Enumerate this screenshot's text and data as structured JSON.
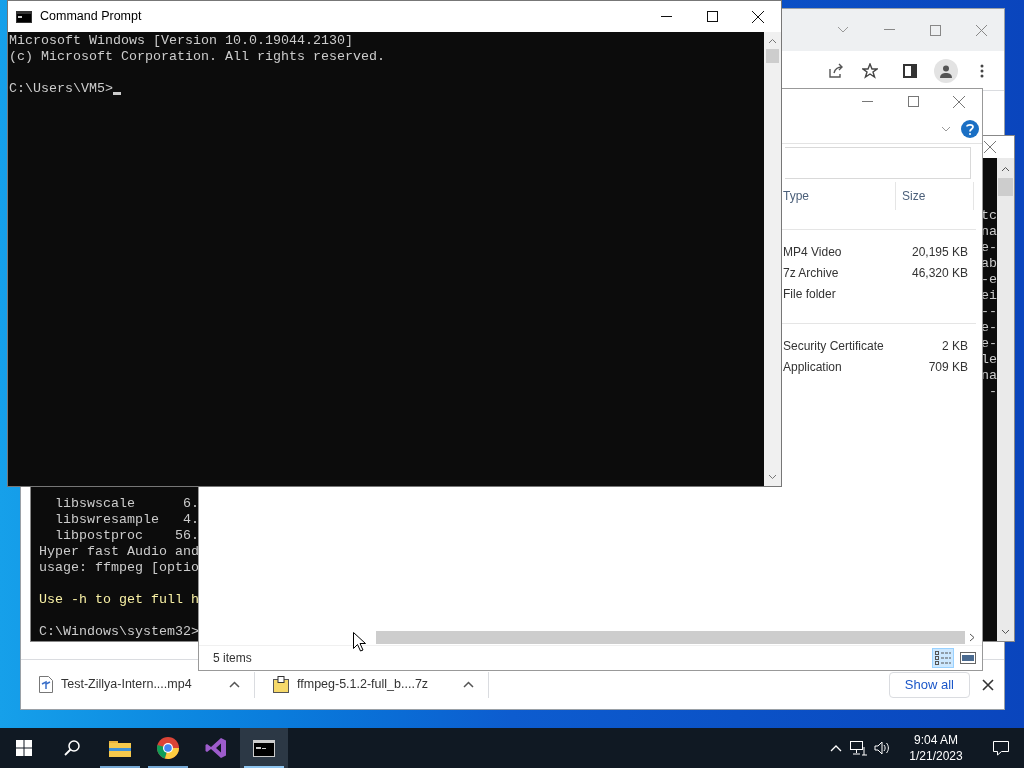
{
  "cmd": {
    "title": "Command Prompt",
    "lines": [
      {
        "kind": "normal",
        "text": "Microsoft Windows [Version 10.0.19044.2130]"
      },
      {
        "kind": "normal",
        "text": "(c) Microsoft Corporation. All rights reserved."
      },
      {
        "kind": "blank"
      },
      {
        "kind": "normal",
        "text": "C:\\Users\\VM5>"
      }
    ],
    "cursor_visible": true
  },
  "console": {
    "right_edge_text": [
      "tc",
      "na",
      "e-",
      "ab",
      "-e",
      "ei",
      "--",
      "e-",
      "e-",
      "le",
      "na",
      " -"
    ],
    "lines": [
      {
        "kind": "normal",
        "text": "  libswscale      6."
      },
      {
        "kind": "normal",
        "text": "  libswresample   4."
      },
      {
        "kind": "normal",
        "text": "  libpostproc    56."
      },
      {
        "kind": "normal",
        "text": "Hyper fast Audio and"
      },
      {
        "kind": "normal",
        "text": "usage: ffmpeg [optio"
      },
      {
        "kind": "blank"
      },
      {
        "kind": "highlight",
        "text": "Use -h to get full h"
      },
      {
        "kind": "blank"
      },
      {
        "kind": "normal",
        "text": "C:\\Windows\\system32>"
      }
    ]
  },
  "explorer": {
    "columns": [
      "Type",
      "Size"
    ],
    "groups": [
      [
        {
          "type": "MP4 Video",
          "size": "20,195 KB"
        },
        {
          "type": "7z Archive",
          "size": "46,320 KB"
        },
        {
          "type": "File folder"
        }
      ],
      [
        {
          "type": "Security Certificate",
          "size": "2 KB"
        },
        {
          "type": "Application",
          "size": "709 KB"
        }
      ]
    ],
    "status": "5 items",
    "views": [
      {
        "kind": "details",
        "selected": true
      },
      {
        "kind": "large_icons",
        "selected": false
      }
    ]
  },
  "browser": {
    "downloads": [
      {
        "kind": "video",
        "name": "Test-Zillya-Intern....mp4"
      },
      {
        "kind": "archive",
        "name": "ffmpeg-5.1.2-full_b....7z"
      }
    ],
    "show_all": "Show all"
  },
  "taskbar": {
    "apps": [
      {
        "kind": "file_explorer",
        "running": true,
        "selected": false
      },
      {
        "kind": "chrome",
        "running": true,
        "selected": false
      },
      {
        "kind": "visual_studio",
        "running": false,
        "selected": false
      },
      {
        "kind": "terminal",
        "running": true,
        "selected": true
      }
    ],
    "time": "9:04 AM",
    "date": "1/21/2023"
  }
}
